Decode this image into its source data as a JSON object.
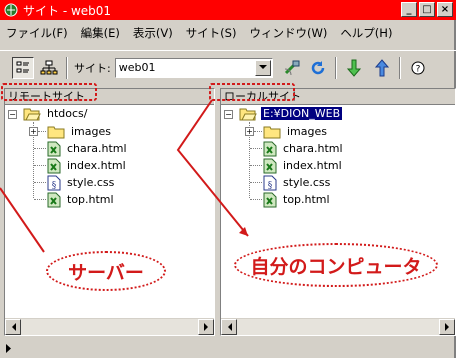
{
  "window": {
    "title": "サイト - web01",
    "buttons": [
      "_",
      "□",
      "×"
    ]
  },
  "menu": [
    "ファイル(F)",
    "編集(E)",
    "表示(V)",
    "サイト(S)",
    "ウィンドウ(W)",
    "ヘルプ(H)"
  ],
  "toolbar": {
    "site_label": "サイト:",
    "site_value": "web01"
  },
  "left_pane": {
    "header": "リモートサイト",
    "root": "htdocs/",
    "items": [
      "images",
      "chara.html",
      "index.html",
      "style.css",
      "top.html"
    ]
  },
  "right_pane": {
    "header": "ローカルサイト",
    "root": "E:¥DION_WEB",
    "items": [
      "images",
      "chara.html",
      "index.html",
      "style.css",
      "top.html"
    ]
  },
  "annotations": {
    "server": "サーバー",
    "local": "自分のコンピュータ"
  },
  "colors": {
    "titlebar": "#ff0000",
    "selection": "#000080",
    "annotation": "#d21a1a"
  }
}
